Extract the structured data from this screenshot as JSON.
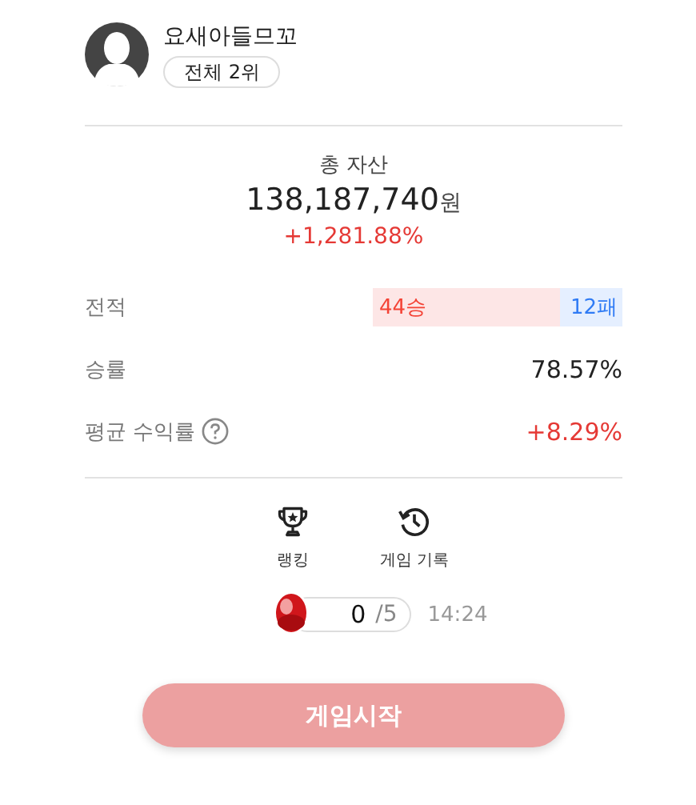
{
  "profile": {
    "name": "요새아들므꼬",
    "rank_badge": "전체 2위"
  },
  "assets": {
    "label": "총 자산",
    "amount": "138,187,740",
    "unit": "원",
    "change": "+1,281.88%"
  },
  "stats": [
    {
      "kind": "record",
      "label": "전적",
      "wins": "44승",
      "losses": "12패"
    },
    {
      "kind": "value",
      "label": "승률",
      "value": "78.57%",
      "positive": false
    },
    {
      "kind": "value",
      "label": "평균 수익률",
      "value": "+8.29%",
      "positive": true,
      "help": true
    }
  ],
  "actions": [
    {
      "kind": "ranking",
      "label": "랭킹"
    },
    {
      "kind": "history",
      "label": "게임 기록"
    }
  ],
  "energy": {
    "count": "0",
    "max": "/5",
    "timer": "14:24"
  },
  "start_button": {
    "label": "게임시작",
    "disabled": true
  }
}
